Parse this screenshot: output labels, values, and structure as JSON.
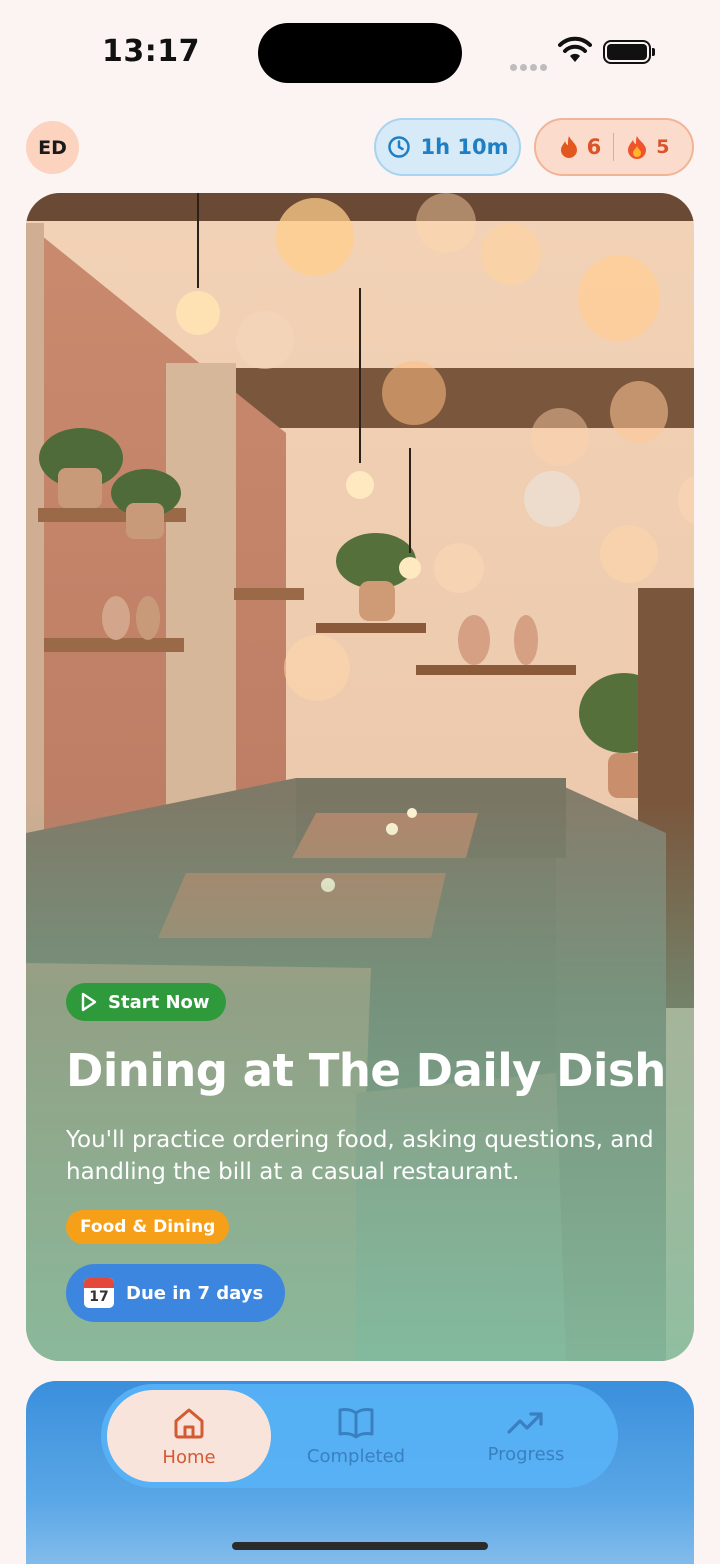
{
  "status_bar": {
    "time": "13:17"
  },
  "header": {
    "avatar_initials": "ED",
    "time_spent": "1h 10m",
    "streak_current": "6",
    "streak_best": "5"
  },
  "hero": {
    "start_label": "Start Now",
    "title": "Dining at The Daily Dish",
    "description": "You'll practice ordering food, asking questions, and handling the bill at a casual restaurant.",
    "category": "Food & Dining",
    "due_label": "Due in 7 days",
    "calendar_day": "17"
  },
  "tabbar": {
    "tabs": [
      {
        "label": "Home",
        "icon": "home-icon",
        "active": true
      },
      {
        "label": "Completed",
        "icon": "book-icon",
        "active": false
      },
      {
        "label": "Progress",
        "icon": "trending-up-icon",
        "active": false
      }
    ]
  },
  "colors": {
    "background": "#fbf4f2",
    "start_green": "#2f9a3b",
    "category_orange": "#f6a01a",
    "due_blue": "#3d86e0",
    "active_tab": "#d45a33"
  }
}
